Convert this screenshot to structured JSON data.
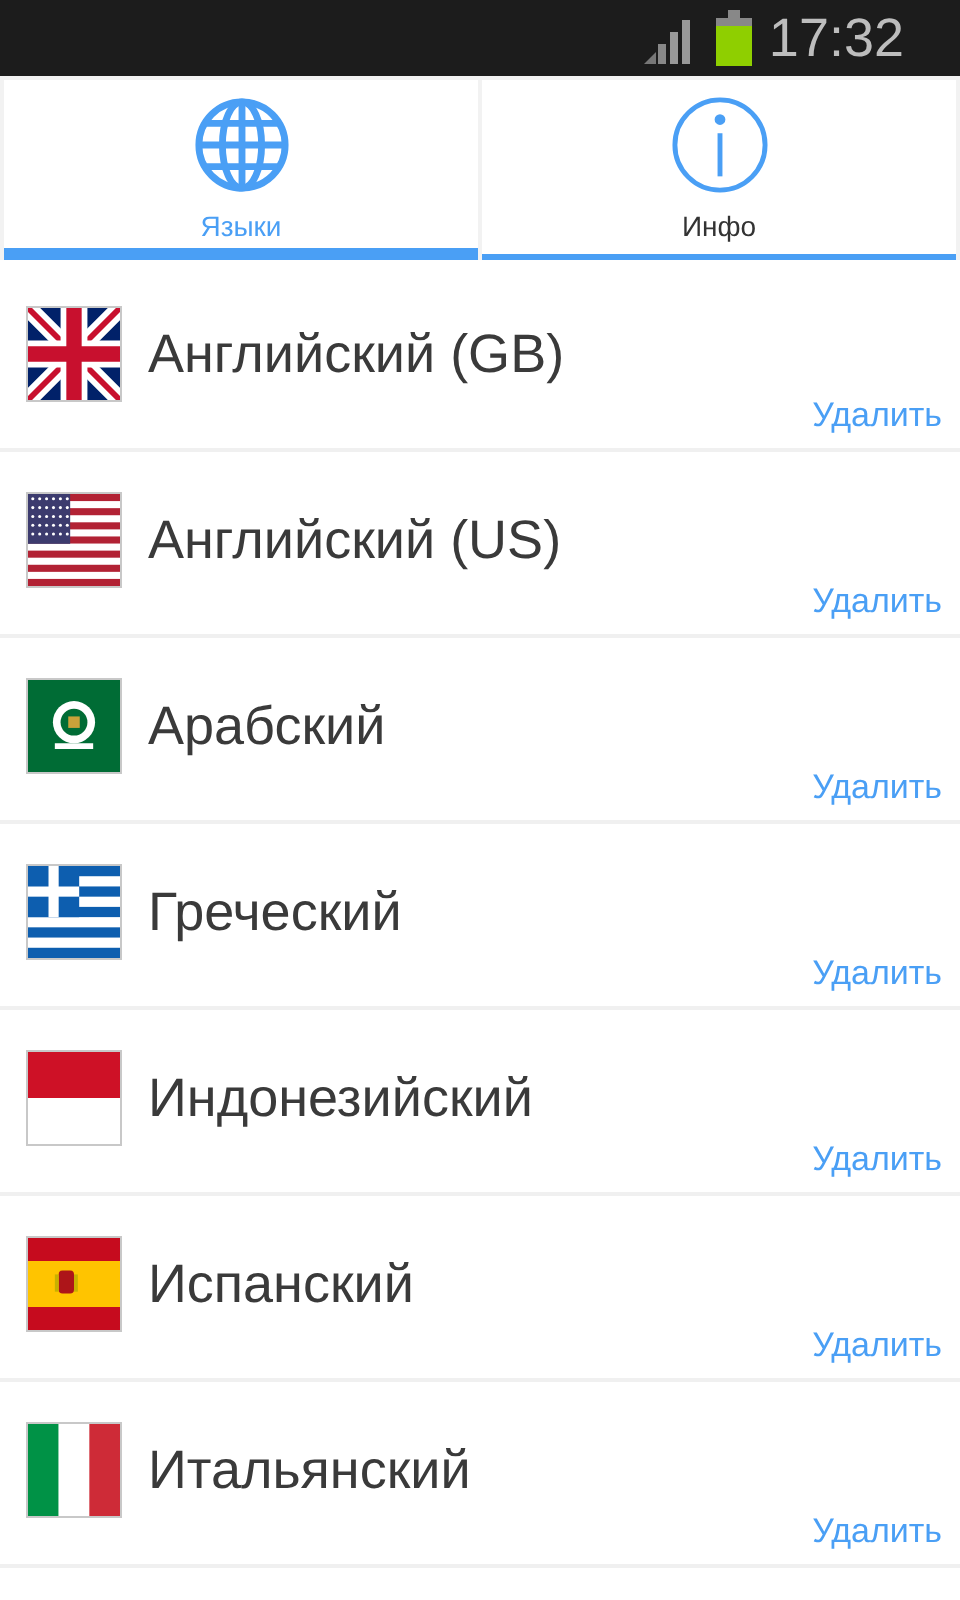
{
  "status_bar": {
    "time": "17:32"
  },
  "tabs": [
    {
      "label": "Языки",
      "selected": true
    },
    {
      "label": "Инфо",
      "selected": false
    }
  ],
  "languages": [
    {
      "name": "Английский (GB)",
      "kind": "gb",
      "action": "Удалить"
    },
    {
      "name": "Английский (US)",
      "kind": "us",
      "action": "Удалить"
    },
    {
      "name": "Арабский",
      "kind": "arab",
      "action": "Удалить"
    },
    {
      "name": "Греческий",
      "kind": "gr",
      "action": "Удалить"
    },
    {
      "name": "Индонезийский",
      "kind": "id",
      "action": "Удалить"
    },
    {
      "name": "Испанский",
      "kind": "es",
      "action": "Удалить"
    },
    {
      "name": "Итальянский",
      "kind": "it",
      "action": "Удалить"
    }
  ]
}
